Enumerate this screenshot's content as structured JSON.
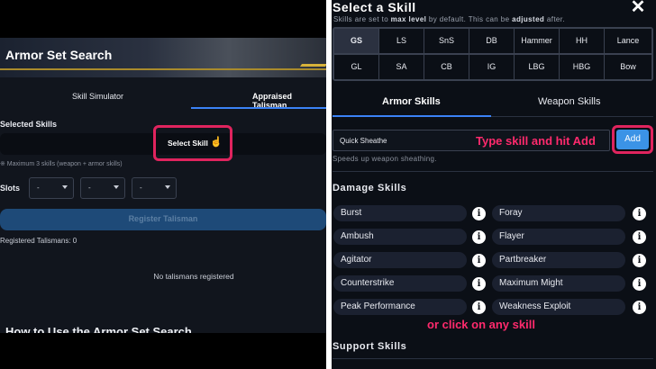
{
  "left": {
    "title": "Armor Set Search",
    "tabs": [
      "Skill Simulator",
      "Appraised Talisman"
    ],
    "selected_label": "Selected Skills",
    "select_skill_btn": "Select Skill",
    "note": "※ Maximum 3 skills (weapon + armor skills)",
    "slots_label": "Slots",
    "slot_value": "-",
    "register_btn": "Register Talisman",
    "registered_count": "Registered Talismans: 0",
    "empty_msg": "No talismans registered",
    "howto": "How to Use the Armor Set Search"
  },
  "right": {
    "title": "Select a Skill",
    "close": "✕",
    "sub_pre": "Skills are set to ",
    "sub_b1": "max level",
    "sub_mid": " by default. This can be ",
    "sub_b2": "adjusted",
    "sub_post": " after.",
    "weapons": [
      "GS",
      "LS",
      "SnS",
      "DB",
      "Hammer",
      "HH",
      "Lance",
      "GL",
      "SA",
      "CB",
      "IG",
      "LBG",
      "HBG",
      "Bow"
    ],
    "selected_weapon": "GS",
    "tabs": [
      "Armor Skills",
      "Weapon Skills"
    ],
    "input_value": "Quick Sheathe",
    "callout_add": "Type skill and hit Add",
    "add_btn": "Add",
    "input_desc": "Speeds up weapon sheathing.",
    "damage_heading": "Damage Skills",
    "damage_skills": [
      "Burst",
      "Foray",
      "Ambush",
      "Flayer",
      "Agitator",
      "Partbreaker",
      "Counterstrike",
      "Maximum Might",
      "Peak Performance",
      "Weakness Exploit"
    ],
    "callout_click": "or click on any skill",
    "support_heading": "Support Skills",
    "info_glyph": "i"
  },
  "colors": {
    "accent": "#3b82f6",
    "highlight": "#e0245e",
    "callout": "#ff2a6d",
    "gold": "#a98b2c"
  }
}
